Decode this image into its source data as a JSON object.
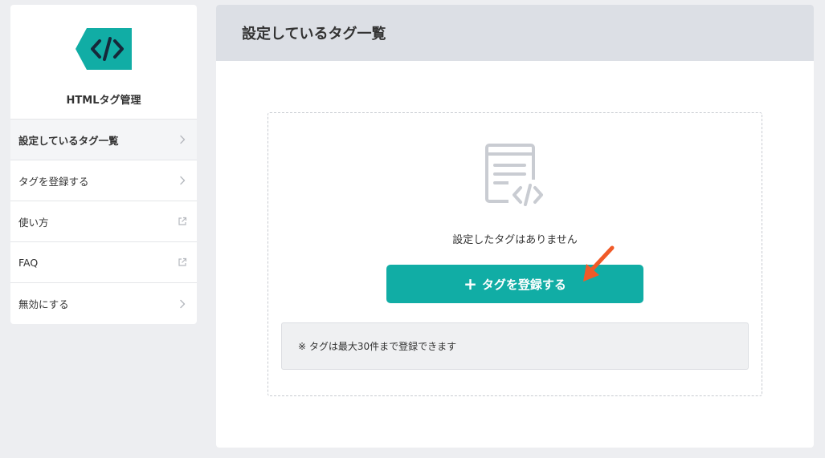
{
  "brand": {
    "title": "HTMLタグ管理",
    "logo_icon": "code-tag-icon",
    "logo_color": "#11ada5"
  },
  "sidebar": {
    "items": [
      {
        "label": "設定しているタグ一覧",
        "icon": "chevron-right-icon",
        "active": true
      },
      {
        "label": "タグを登録する",
        "icon": "chevron-right-icon",
        "active": false
      },
      {
        "label": "使い方",
        "icon": "external-link-icon",
        "active": false
      },
      {
        "label": "FAQ",
        "icon": "external-link-icon",
        "active": false
      },
      {
        "label": "無効にする",
        "icon": "chevron-right-icon",
        "active": false
      }
    ]
  },
  "main": {
    "title": "設定しているタグ一覧",
    "empty_icon": "code-document-icon",
    "empty_message": "設定したタグはありません",
    "add_button_icon": "plus-icon",
    "add_button_label": "タグを登録する",
    "note": "※ タグは最大30件まで登録できます"
  },
  "colors": {
    "accent": "#11ada5",
    "annotation_arrow": "#f05a28",
    "header_bg": "#dcdfe5"
  }
}
